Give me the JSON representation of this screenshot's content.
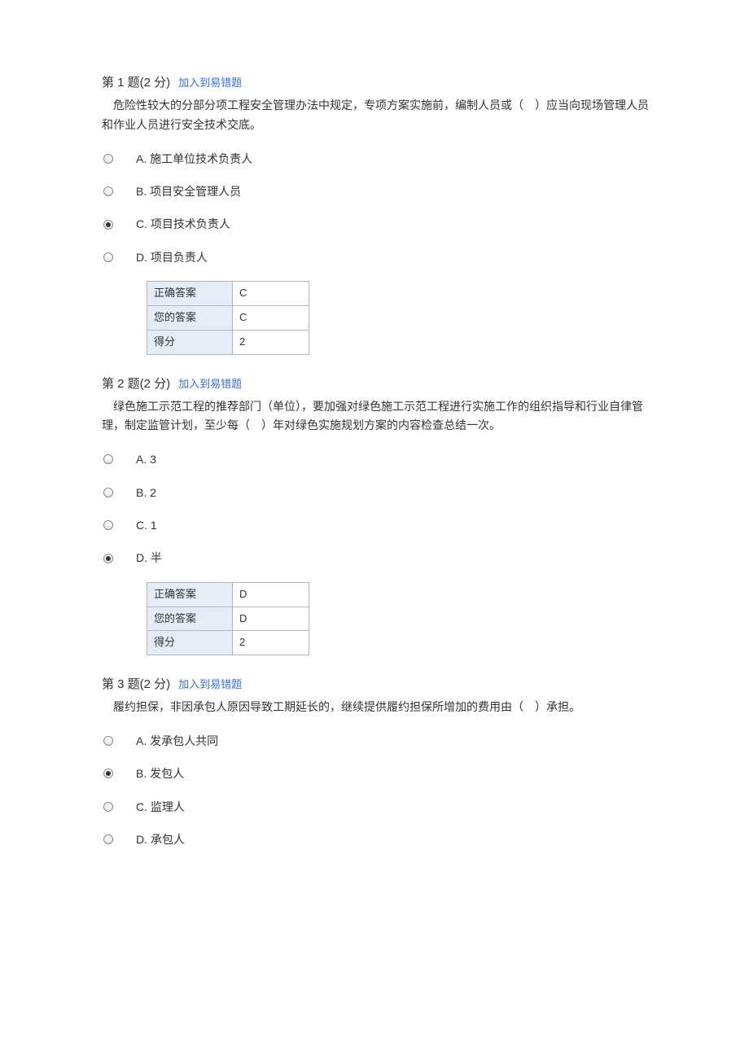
{
  "questions": [
    {
      "number": "第 1 题(2 分)",
      "add_link": "加入到易错题",
      "text": "危险性较大的分部分项工程安全管理办法中规定，专项方案实施前，编制人员或（　）应当向现场管理人员和作业人员进行安全技术交底。",
      "options": [
        {
          "label": "A. 施工单位技术负责人",
          "selected": false
        },
        {
          "label": "B. 项目安全管理人员",
          "selected": false
        },
        {
          "label": "C. 项目技术负责人",
          "selected": true
        },
        {
          "label": "D. 项目负责人",
          "selected": false
        }
      ],
      "answer": {
        "correct_label": "正确答案",
        "correct_value": "C",
        "your_label": "您的答案",
        "your_value": "C",
        "score_label": "得分",
        "score_value": "2"
      }
    },
    {
      "number": "第 2 题(2 分)",
      "add_link": "加入到易错题",
      "text": "绿色施工示范工程的推荐部门（单位），要加强对绿色施工示范工程进行实施工作的组织指导和行业自律管理，制定监管计划，至少每（　）年对绿色实施规划方案的内容检查总结一次。",
      "options": [
        {
          "label": "A. 3",
          "selected": false
        },
        {
          "label": "B. 2",
          "selected": false
        },
        {
          "label": "C. 1",
          "selected": false
        },
        {
          "label": "D. 半",
          "selected": true
        }
      ],
      "answer": {
        "correct_label": "正确答案",
        "correct_value": "D",
        "your_label": "您的答案",
        "your_value": "D",
        "score_label": "得分",
        "score_value": "2"
      }
    },
    {
      "number": "第 3 题(2 分)",
      "add_link": "加入到易错题",
      "text": "履约担保，非因承包人原因导致工期延长的，继续提供履约担保所增加的费用由（　）承担。",
      "options": [
        {
          "label": "A. 发承包人共同",
          "selected": false
        },
        {
          "label": "B. 发包人",
          "selected": true
        },
        {
          "label": "C. 监理人",
          "selected": false
        },
        {
          "label": "D. 承包人",
          "selected": false
        }
      ],
      "answer": null
    }
  ]
}
